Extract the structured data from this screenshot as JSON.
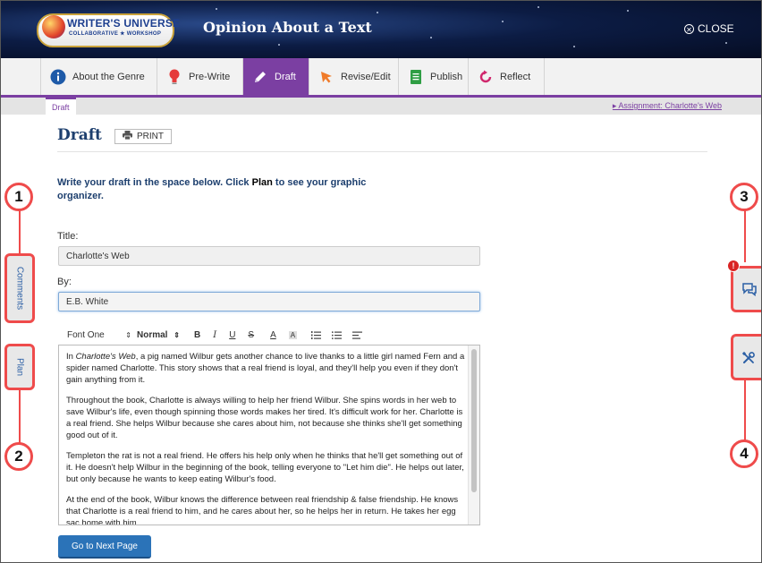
{
  "header": {
    "logo_text": "WRITER'S UNIVERSE",
    "logo_subtext": "COLLABORATIVE ★ WORKSHOP",
    "title": "Opinion About a Text",
    "close_label": "CLOSE"
  },
  "tabs": [
    {
      "label": "About the Genre",
      "icon": "info-icon"
    },
    {
      "label": "Pre-Write",
      "icon": "lightbulb-icon"
    },
    {
      "label": "Draft",
      "icon": "pencil-icon",
      "active": true
    },
    {
      "label": "Revise/Edit",
      "icon": "cursor-icon"
    },
    {
      "label": "Publish",
      "icon": "document-icon"
    },
    {
      "label": "Reflect",
      "icon": "refresh-icon"
    }
  ],
  "subbar": {
    "crumb": "Draft",
    "assignment_link": "▸ Assignment: Charlotte's Web"
  },
  "main": {
    "page_title": "Draft",
    "print_label": "PRINT",
    "instruction_before": "Write your draft in the space below. Click ",
    "instruction_plan": "Plan",
    "instruction_after": " to see your graphic organizer.",
    "title_label": "Title:",
    "title_value": "Charlotte's Web",
    "by_label": "By:",
    "by_value": "E.B. White",
    "next_button": "Go to Next Page"
  },
  "toolbar": {
    "font_select": "Font One",
    "size_select": "Normal",
    "bold": "B",
    "italic": "I",
    "underline": "U",
    "strike": "S",
    "font_color": "A",
    "highlight": "A"
  },
  "editor": {
    "p1_book": "Charlotte's Web",
    "p1_before": "In ",
    "p1_after": ", a pig named Wilbur gets another chance to live thanks to a little girl named Fern and a spider named Charlotte. This story shows that a real friend is loyal, and they'll help you even if they don't gain anything from it.",
    "p2": "Throughout the book, Charlotte is always willing to help her friend Wilbur. She spins words in her web to save Wilbur's life, even though spinning those words makes her tired. It's difficult work for her. Charlotte is a real friend. She helps Wilbur because she cares about him, not because she thinks she'll get something good out of it.",
    "p3": "Templeton the rat is not a real friend. He offers his help only when he thinks that he'll get something out of it. He doesn't help Wilbur in the beginning of the book, telling everyone to \"Let him die\". He helps out later, but only because he wants to keep eating Wilbur's food.",
    "p4": "At the end of the book, Wilbur knows the difference between real friendship & false friendship. He knows that Charlotte is a real friend to him, and he cares about her, so he helps her in return. He takes her egg sac home with him."
  },
  "side": {
    "comments_label": "Comments",
    "plan_label": "Plan",
    "alert_count": "!"
  },
  "callouts": [
    "1",
    "2",
    "3",
    "4"
  ],
  "colors": {
    "accent": "#7b3fa2",
    "title_blue": "#1d3f6e",
    "button_blue": "#2b73b8",
    "callout_red": "#ef4b4b"
  }
}
